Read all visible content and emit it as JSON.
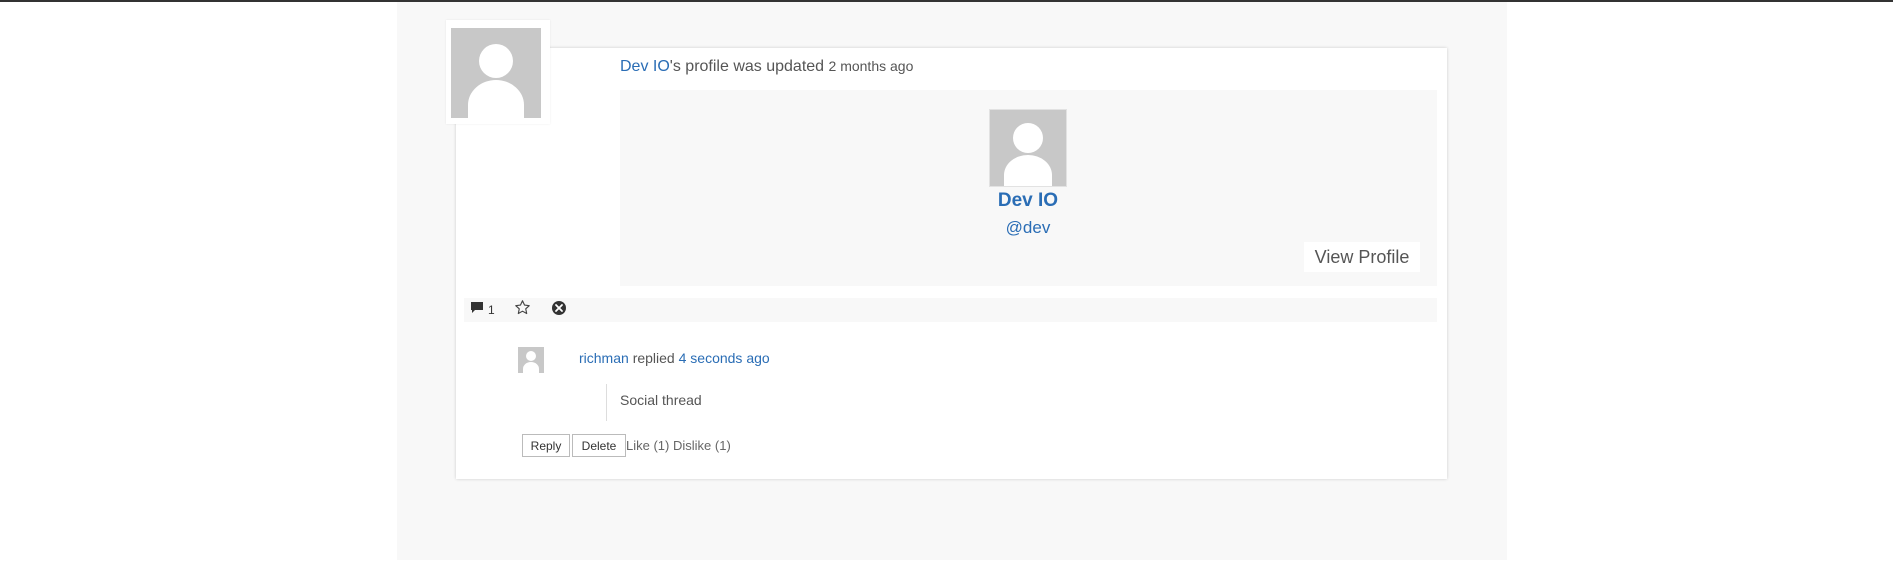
{
  "activity": {
    "user_name": "Dev IO",
    "action_text": "'s profile was updated",
    "time_ago": "2 months ago"
  },
  "profile_card": {
    "name": "Dev IO",
    "handle": "@dev",
    "view_profile_label": "View Profile"
  },
  "actions": {
    "comment_count": "1",
    "icons": [
      "comment-icon",
      "star-icon",
      "close-circle-icon"
    ]
  },
  "reply": {
    "author": "richman",
    "verb": "replied",
    "time_ago": "4 seconds ago",
    "text": "Social thread",
    "reply_label": "Reply",
    "delete_label": "Delete",
    "like_label": "Like (1)",
    "dislike_label": "Dislike (1)"
  },
  "colors": {
    "link": "#2a6db5",
    "background": "#f8f8f8",
    "avatar_placeholder": "#c8c8c8"
  }
}
